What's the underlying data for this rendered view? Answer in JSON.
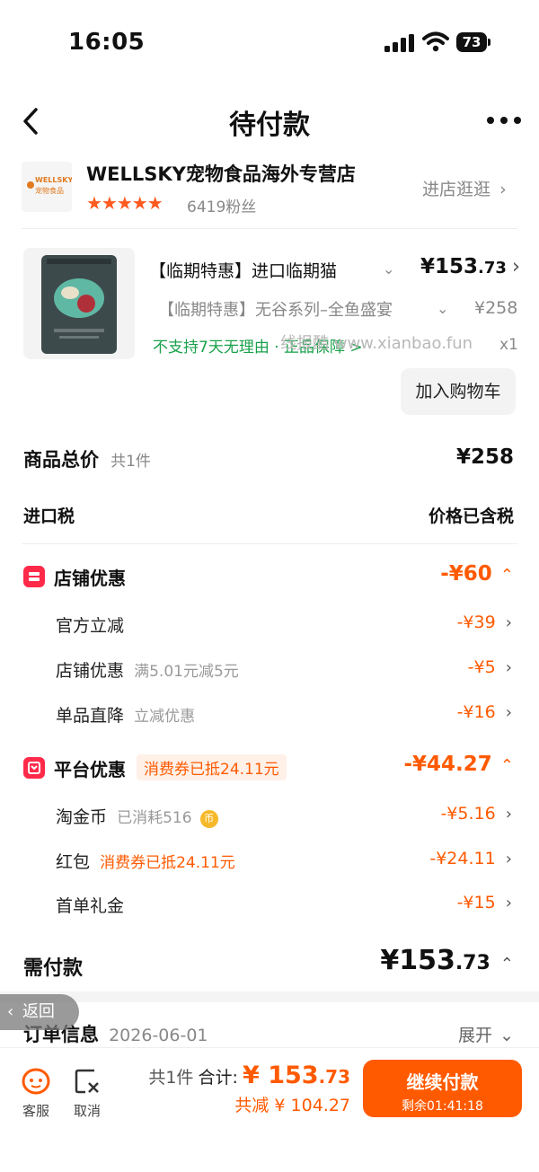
{
  "status_bar": {
    "time": "16:05",
    "battery": "73"
  },
  "nav": {
    "title": "待付款"
  },
  "shop": {
    "logo_text_top": "WELLSKY",
    "logo_text_bottom": "宠物食品",
    "name": "WELLSKY宠物食品海外专营店",
    "rating": 4.5,
    "stars": "★★★★★",
    "fans": "6419粉丝",
    "enter_label": "进店逛逛"
  },
  "product": {
    "title": "【临期特惠】进口临期猫",
    "price_main": "¥153",
    "price_decimal": ".73",
    "sku": "【临期特惠】无谷系列–全鱼盛宴",
    "original_price": "¥258",
    "guarantee": "不支持7天无理由 · 正品保障 >",
    "watermark": "线报酷 www.xianbao.fun",
    "quantity": "x1",
    "add_cart": "加入购物车"
  },
  "summary": {
    "total_label": "商品总价",
    "total_count": "共1件",
    "total_value": "¥258",
    "tax_label": "进口税",
    "tax_value": "价格已含税"
  },
  "shop_discount": {
    "label": "店铺优惠",
    "value": "-¥60",
    "items": [
      {
        "label": "官方立减",
        "note": "",
        "value": "-¥39"
      },
      {
        "label": "店铺优惠",
        "note": "满5.01元减5元",
        "value": "-¥5"
      },
      {
        "label": "单品直降",
        "note": "立减优惠",
        "value": "-¥16"
      }
    ]
  },
  "platform_discount": {
    "label": "平台优惠",
    "tag": "消费券已抵24.11元",
    "value": "-¥44.27",
    "items": [
      {
        "label": "淘金币",
        "note": "已消耗516",
        "value": "-¥5.16"
      },
      {
        "label": "红包",
        "note": "消费券已抵24.11元",
        "value": "-¥24.11"
      },
      {
        "label": "首单礼金",
        "note": "",
        "value": "-¥15"
      }
    ]
  },
  "payable": {
    "label": "需付款",
    "value_main": "¥153",
    "value_decimal": ".73"
  },
  "order_info": {
    "label": "订单信息",
    "date": "2026-06-01",
    "expand": "展开"
  },
  "floating_back": "返回",
  "bottom_bar": {
    "service_label": "客服",
    "cancel_label": "取消",
    "count": "共1件",
    "total_label": "合计:",
    "total_main": "¥ 153",
    "total_decimal": ".73",
    "saved": "共减 ¥ 104.27",
    "pay_label": "继续付款",
    "countdown": "剩余01:41:18"
  },
  "colors": {
    "accent": "#ff5a00",
    "badge_red": "#ff2a4a",
    "green": "#19a14a"
  }
}
